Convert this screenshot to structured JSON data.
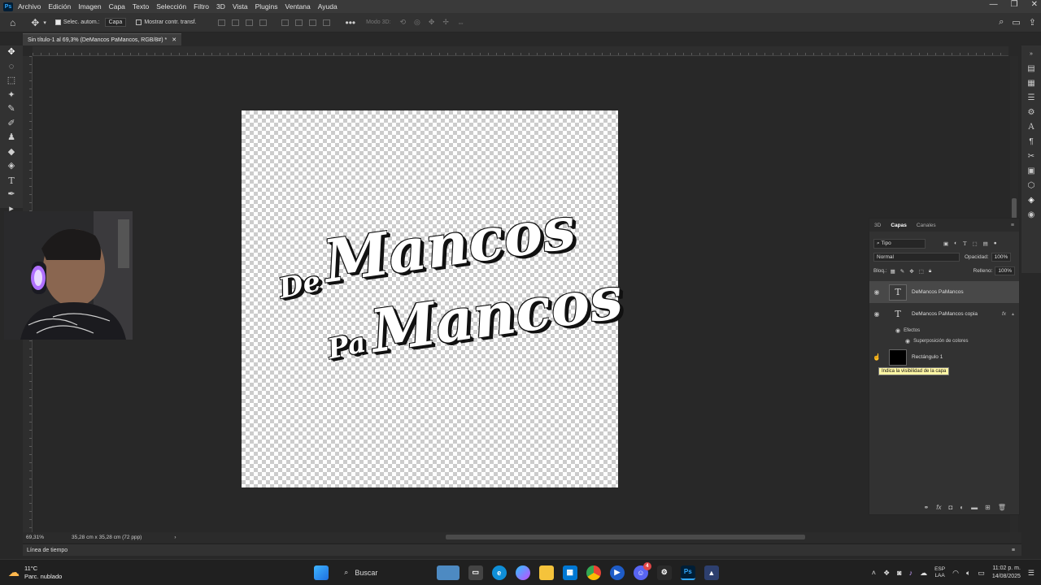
{
  "menubar": {
    "logo": "Ps",
    "items": [
      "Archivo",
      "Edición",
      "Imagen",
      "Capa",
      "Texto",
      "Selección",
      "Filtro",
      "3D",
      "Vista",
      "Plugins",
      "Ventana",
      "Ayuda"
    ]
  },
  "options": {
    "auto_select_label": "Selec. autom.:",
    "auto_select_target": "Capa",
    "show_transform_label": "Mostrar contr. transf.",
    "mode_3d_label": "Modo 3D:"
  },
  "document": {
    "tab_title": "Sin título-1 al 69,3% (DeMancos    PaMancos, RGB/8#) *",
    "art_line1_small": "De",
    "art_line1_big": "Mancos",
    "art_line2_small": "Pa",
    "art_line2_big": "Mancos"
  },
  "layers_panel": {
    "tabs": [
      "3D",
      "Capas",
      "Canales"
    ],
    "active_tab": "Capas",
    "filter_label": "Tipo",
    "blend_mode": "Normal",
    "opacity_label": "Opacidad:",
    "opacity_value": "100%",
    "lock_label": "Bloq.:",
    "fill_label": "Relleno:",
    "fill_value": "100%",
    "layers": [
      {
        "name": "DeMancos    PaMancos",
        "type": "text",
        "selected": true
      },
      {
        "name": "DeMancos    PaMancos copia",
        "type": "text",
        "fx": "fx"
      },
      {
        "name": "Rectángulo 1",
        "type": "shape"
      }
    ],
    "effects_label": "Efectos",
    "effect_item": "Superposición de colores",
    "tooltip": "Indica la visibilidad de la capa"
  },
  "status": {
    "zoom": "69,31%",
    "dimensions": "35,28 cm x 35,28 cm (72 ppp)"
  },
  "timeline": {
    "label": "Línea de tiempo"
  },
  "taskbar": {
    "weather_temp": "11°C",
    "weather_desc": "Parc. nublado",
    "search_label": "Buscar",
    "lang1": "ESP",
    "lang2": "LAA",
    "time": "11:02 p. m.",
    "date": "14/08/2025",
    "badge_count": "4"
  },
  "colors": {
    "ps_accent": "#31a8ff",
    "tooltip_bg": "#fff6a5"
  }
}
